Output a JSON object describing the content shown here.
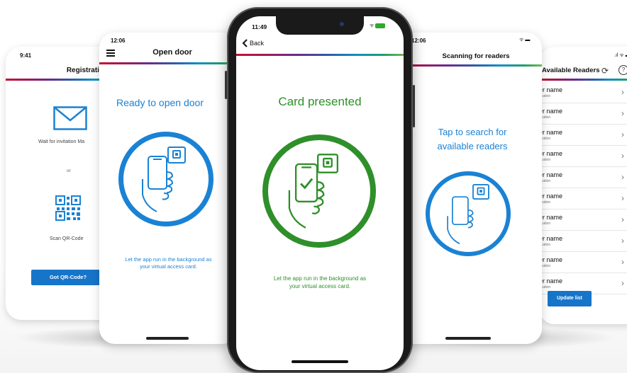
{
  "screens": {
    "registration": {
      "time": "9:41",
      "title": "Registration",
      "mail_label": "Wait for invitation Ma",
      "or_label": "or",
      "qr_label": "Scan QR-Code",
      "button_label": "Got QR-Code?"
    },
    "open_door": {
      "time": "12:06",
      "title": "Open door",
      "heading": "Ready to open door",
      "hint_line1": "Let the app run in the background as",
      "hint_line2": "your virtual access card."
    },
    "card_presented": {
      "time": "11:49",
      "back_label": "Back",
      "heading": "Card presented",
      "hint_line1": "Let the app run in the background as",
      "hint_line2": "your virtual access card."
    },
    "scanning": {
      "time": "12:06",
      "title": "Scanning for readers",
      "tap_line1": "Tap to search for",
      "tap_line2": "available readers"
    },
    "available_readers": {
      "title": "Available Readers",
      "help_glyph": "?",
      "update_label": "Update list",
      "rows": [
        {
          "name": "er name",
          "location": "ocation"
        },
        {
          "name": "er name",
          "location": "ocation"
        },
        {
          "name": "er name",
          "location": "ocation"
        },
        {
          "name": "er name",
          "location": "ocation"
        },
        {
          "name": "er name",
          "location": "ocation"
        },
        {
          "name": "er name",
          "location": "ocation"
        },
        {
          "name": "er name",
          "location": "ocation"
        },
        {
          "name": "er name",
          "location": "ocation"
        },
        {
          "name": "er name",
          "location": "ocation"
        },
        {
          "name": "er name",
          "location": "ocation"
        }
      ]
    }
  },
  "icons": [
    "envelope-icon",
    "qr-code-icon",
    "menu-icon",
    "phone-hand-icon",
    "card-reader-icon",
    "back-chevron-icon",
    "chevron-right-icon",
    "refresh-icon",
    "help-icon",
    "wifi-icon",
    "battery-icon",
    "signal-icon"
  ],
  "colors": {
    "accent_blue": "#1a82d4",
    "accent_green": "#2f8f2a",
    "button_blue": "#1675c9",
    "frame_black": "#1a1a1a"
  }
}
